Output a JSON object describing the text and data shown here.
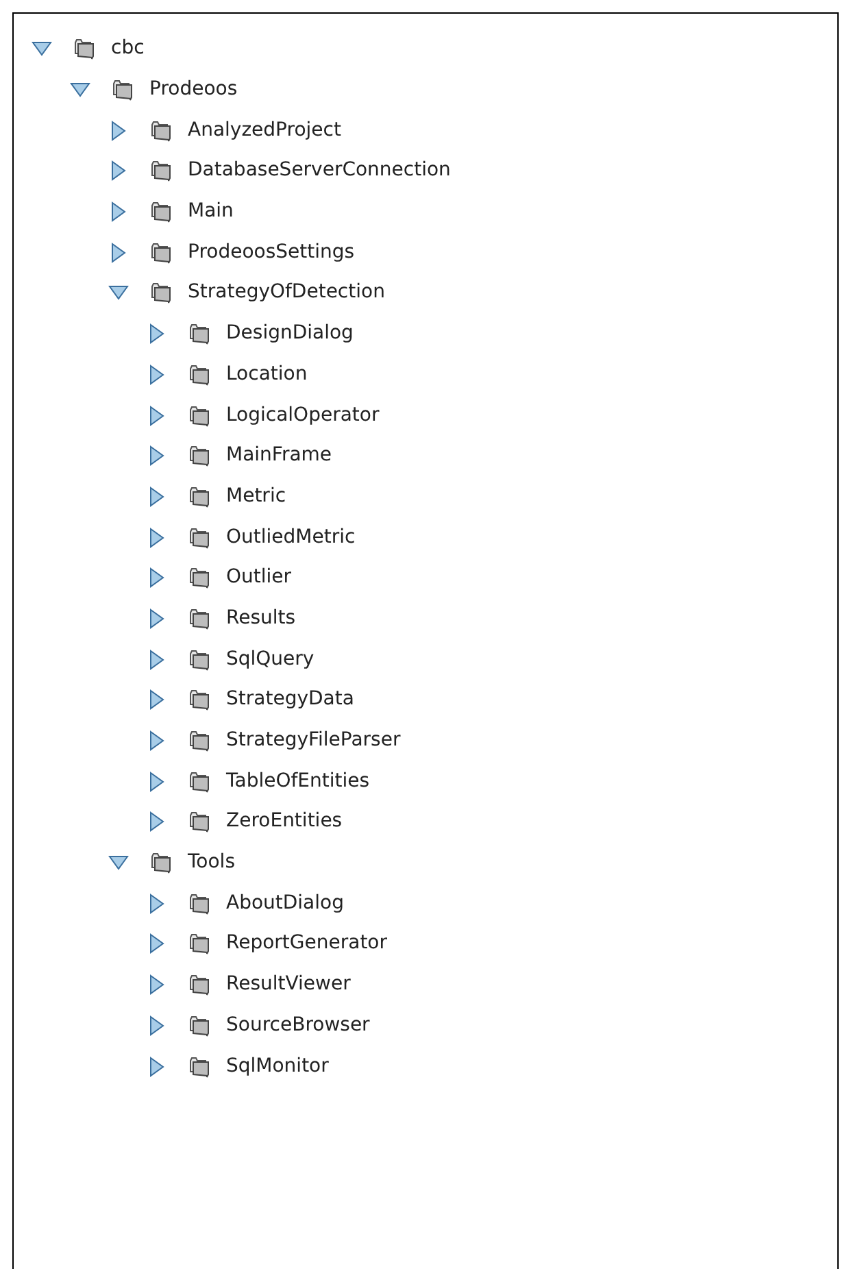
{
  "tree": [
    {
      "label": "cbc",
      "expanded": true,
      "children": [
        {
          "label": "Prodeoos",
          "expanded": true,
          "children": [
            {
              "label": "AnalyzedProject",
              "expanded": false
            },
            {
              "label": "DatabaseServerConnection",
              "expanded": false
            },
            {
              "label": "Main",
              "expanded": false
            },
            {
              "label": "ProdeoosSettings",
              "expanded": false
            },
            {
              "label": "StrategyOfDetection",
              "expanded": true,
              "children": [
                {
                  "label": "DesignDialog",
                  "expanded": false
                },
                {
                  "label": "Location",
                  "expanded": false
                },
                {
                  "label": "LogicalOperator",
                  "expanded": false
                },
                {
                  "label": "MainFrame",
                  "expanded": false
                },
                {
                  "label": "Metric",
                  "expanded": false
                },
                {
                  "label": "OutliedMetric",
                  "expanded": false
                },
                {
                  "label": "Outlier",
                  "expanded": false
                },
                {
                  "label": "Results",
                  "expanded": false
                },
                {
                  "label": "SqlQuery",
                  "expanded": false
                },
                {
                  "label": "StrategyData",
                  "expanded": false
                },
                {
                  "label": "StrategyFileParser",
                  "expanded": false
                },
                {
                  "label": "TableOfEntities",
                  "expanded": false
                },
                {
                  "label": "ZeroEntities",
                  "expanded": false
                }
              ]
            },
            {
              "label": "Tools",
              "expanded": true,
              "children": [
                {
                  "label": "AboutDialog",
                  "expanded": false
                },
                {
                  "label": "ReportGenerator",
                  "expanded": false
                },
                {
                  "label": "ResultViewer",
                  "expanded": false
                },
                {
                  "label": "SourceBrowser",
                  "expanded": false
                },
                {
                  "label": "SqlMonitor",
                  "expanded": false
                }
              ]
            }
          ]
        }
      ]
    }
  ]
}
